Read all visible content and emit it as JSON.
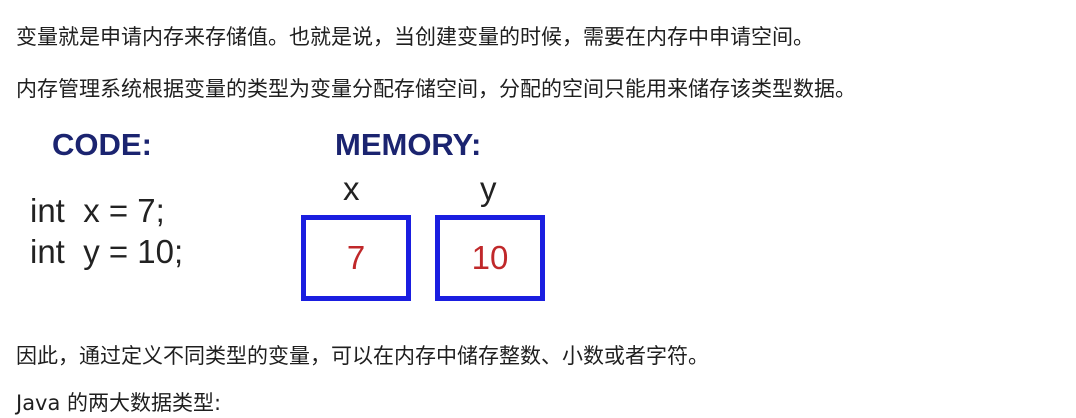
{
  "paragraphs": {
    "p1": "变量就是申请内存来存储值。也就是说，当创建变量的时候，需要在内存中申请空间。",
    "p2": "内存管理系统根据变量的类型为变量分配存储空间，分配的空间只能用来储存该类型数据。",
    "p3": "因此，通过定义不同类型的变量，可以在内存中储存整数、小数或者字符。",
    "p4": "Java 的两大数据类型:"
  },
  "figure": {
    "code_heading": "CODE:",
    "memory_heading": "MEMORY:",
    "code_lines": [
      "int  x = 7;",
      "int  y = 10;"
    ],
    "variables": [
      {
        "name": "x",
        "value": "7"
      },
      {
        "name": "y",
        "value": "10"
      }
    ],
    "colors": {
      "heading": "#1b2470",
      "cell_border": "#1a1ee0",
      "cell_value": "#c0282a"
    }
  }
}
